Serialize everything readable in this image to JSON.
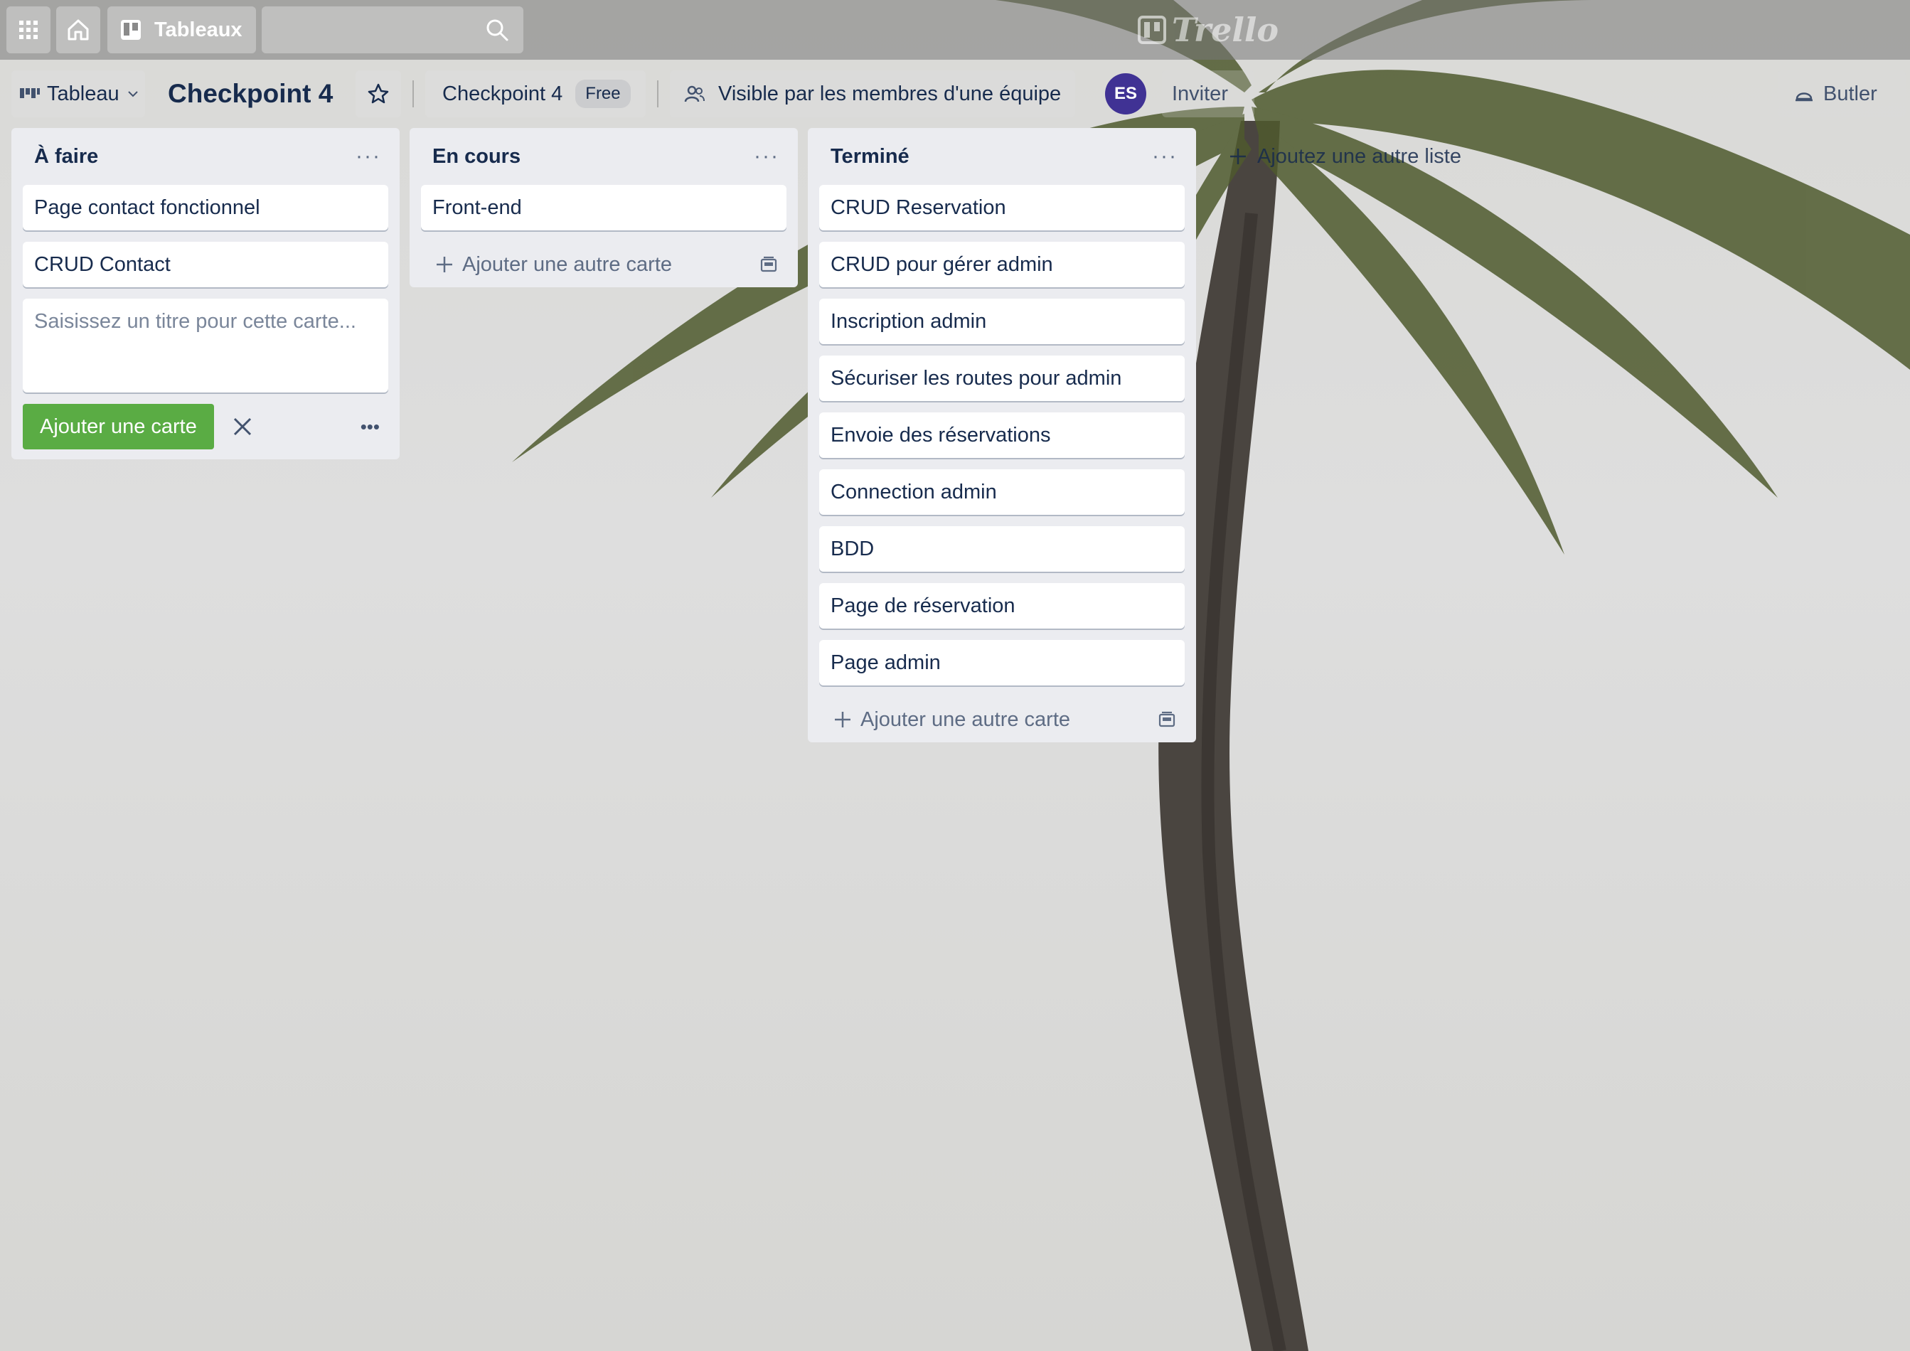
{
  "appbar": {
    "boards_label": "Tableaux",
    "search_placeholder": "",
    "logo_text": "Trello"
  },
  "board_header": {
    "view_label": "Tableau",
    "board_title": "Checkpoint 4",
    "team_name": "Checkpoint 4",
    "team_plan": "Free",
    "visibility": "Visible par les membres d'une équipe",
    "avatar_initials": "ES",
    "invite_label": "Inviter",
    "butler_label": "Butler"
  },
  "lists": [
    {
      "title": "À faire",
      "menu": "···",
      "cards": [
        "Page contact fonctionnel",
        "CRUD Contact"
      ],
      "composer": {
        "placeholder": "Saisissez un titre pour cette carte...",
        "add_button": "Ajouter une carte",
        "close": "✕",
        "more": "•••"
      }
    },
    {
      "title": "En cours",
      "menu": "···",
      "cards": [
        "Front-end"
      ],
      "add_card_label": "Ajouter une autre carte"
    },
    {
      "title": "Terminé",
      "menu": "···",
      "cards": [
        "CRUD Reservation",
        "CRUD pour gérer admin",
        "Inscription admin",
        "Sécuriser les routes pour admin",
        "Envoie des réservations",
        "Connection admin",
        "BDD",
        "Page de réservation",
        "Page admin"
      ],
      "add_card_label": "Ajouter une autre carte"
    }
  ],
  "add_list_label": "Ajoutez une autre liste",
  "colors": {
    "list_bg": "#ebecf0",
    "add_button": "#5aac44",
    "avatar": "#403294"
  },
  "icons": [
    "apps-grid-icon",
    "home-icon",
    "boards-icon",
    "search-icon",
    "trello-logo-icon",
    "board-view-icon",
    "chevron-down-icon",
    "star-icon",
    "team-visibility-icon",
    "plus-icon",
    "card-template-icon",
    "close-icon",
    "butler-icon"
  ]
}
